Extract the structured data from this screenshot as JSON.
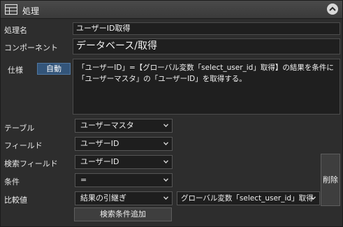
{
  "header": {
    "title": "処理",
    "icon": "table-icon"
  },
  "fields": {
    "name_label": "処理名",
    "name_value": "ユーザーID取得",
    "component_label": "コンポーネント",
    "component_value": "データベース/取得",
    "spec_label": "仕様",
    "auto_button": "自動",
    "spec_text": "「ユーザーID」=【グローバル変数「select_user_id」取得】の結果を条件に「ユーザーマスタ」の「ユーザーID」を取得する。"
  },
  "query": {
    "table_label": "テーブル",
    "table_value": "ユーザーマスタ",
    "field_label": "フィールド",
    "field_value": "ユーザーID",
    "search_field_label": "検索フィールド",
    "search_field_value": "ユーザーID",
    "condition_label": "条件",
    "condition_value": "=",
    "compare_label": "比較値",
    "compare_value": "結果の引継ぎ",
    "compare_source_value": "グローバル変数「select_user_id」取得",
    "delete_button": "削除",
    "add_condition_button": "検索条件追加"
  },
  "colors": {
    "accent": "#33557a",
    "background": "#2d2d2d",
    "field": "#1f1f1f"
  }
}
